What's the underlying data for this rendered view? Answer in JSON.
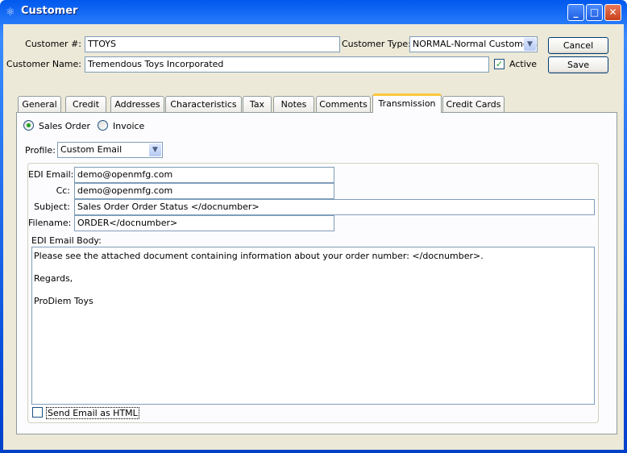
{
  "window": {
    "title": "Customer",
    "icon": "app-icon"
  },
  "header": {
    "customer_number_label": "Customer #:",
    "customer_number": "TTOYS",
    "customer_type_label": "Customer Type:",
    "customer_type": "NORMAL-Normal Customers",
    "customer_name_label": "Customer Name:",
    "customer_name": "Tremendous Toys Incorporated",
    "active_label": "Active",
    "active": true,
    "cancel_label": "Cancel",
    "save_label": "Save"
  },
  "tabs": [
    {
      "label": "General"
    },
    {
      "label": "Credit"
    },
    {
      "label": "Addresses"
    },
    {
      "label": "Characteristics"
    },
    {
      "label": "Tax"
    },
    {
      "label": "Notes"
    },
    {
      "label": "Comments"
    },
    {
      "label": "Transmission",
      "selected": true
    },
    {
      "label": "Credit Cards"
    }
  ],
  "transmission": {
    "sales_order_label": "Sales Order",
    "invoice_label": "Invoice",
    "selected": "Sales Order",
    "profile_label": "Profile:",
    "profile": "Custom Email",
    "edi_email_label": "EDI Email:",
    "edi_email": "demo@openmfg.com",
    "cc_label": "Cc:",
    "cc": "demo@openmfg.com",
    "subject_label": "Subject:",
    "subject": "Sales Order Order Status </docnumber>",
    "filename_label": "Filename:",
    "filename": "ORDER</docnumber>",
    "body_label": "EDI Email Body:",
    "body_lines": [
      "Please see the attached document containing information about your order number: </docnumber>.",
      "",
      "Regards,",
      "",
      "ProDiem Toys"
    ],
    "html_label": "Send Email as HTML",
    "html": false
  }
}
